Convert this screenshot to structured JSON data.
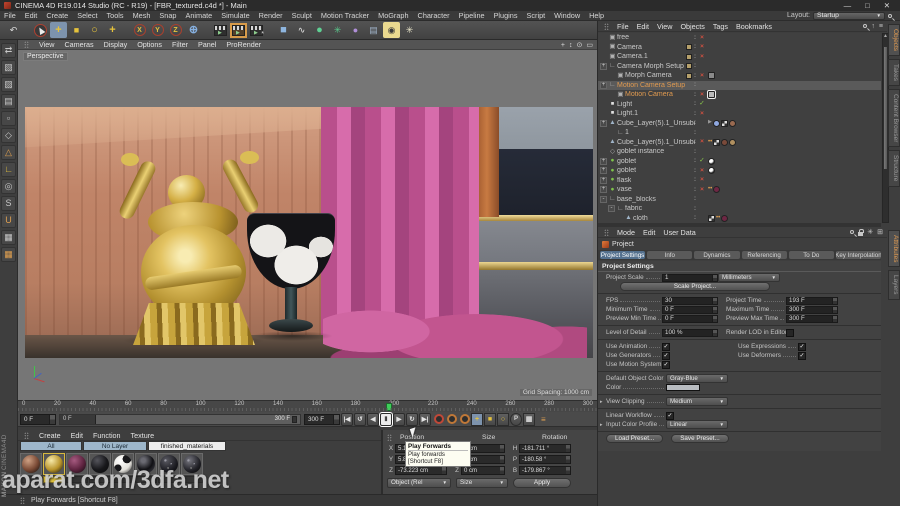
{
  "palette": {
    "accent_orange": "#e09a50",
    "tool_yellow": "#e6c33c",
    "select_blue": "#7d93ad",
    "tab_blue": "#53708e",
    "wood": "#c68e72",
    "wood_light": "#dcae8e",
    "pink": "#c9579a",
    "pink_light": "#d76cab",
    "pink_dark": "#a4447e",
    "sky": "#9aa2ab",
    "navy": "#262b38",
    "gold_trim": "#d8bc6c",
    "wall_gray": "#85888f",
    "gold_hi": "#f8ecb2",
    "gold_mid": "#d4af45",
    "gold_dark": "#6e5415",
    "viewport_gray": "#767676",
    "green_marker": "#3fcf5a",
    "check_green": "#8ed04a",
    "cross_red": "#d05040"
  },
  "window": {
    "title": "CINEMA 4D R19.014 Studio (RC - R19) - [FBR_textured.c4d *] - Main",
    "minimize": "—",
    "maximize": "□",
    "close": "✕"
  },
  "menubar": {
    "items": [
      "File",
      "Edit",
      "Create",
      "Select",
      "Tools",
      "Mesh",
      "Snap",
      "Animate",
      "Simulate",
      "Render",
      "Sculpt",
      "Motion Tracker",
      "MoGraph",
      "Character",
      "Pipeline",
      "Plugins",
      "Script",
      "Window",
      "Help"
    ],
    "layout_label": "Layout:",
    "layout_value": "Startup"
  },
  "main_toolbar": [
    {
      "name": "undo-icon",
      "g": "↶",
      "fg": "#dcdcdc"
    },
    {
      "name": "sep"
    },
    {
      "name": "live-selection-icon",
      "kind": "cursor"
    },
    {
      "name": "move-tool-icon",
      "g": "+",
      "fg": "#e6c33c",
      "bg": "#7d93ad",
      "big": true
    },
    {
      "name": "scale-tool-icon",
      "g": "■",
      "fg": "#e6c33c"
    },
    {
      "name": "rotate-tool-icon",
      "g": "○",
      "fg": "#e6c33c",
      "big": true
    },
    {
      "name": "last-tool-icon",
      "g": "+",
      "fg": "#e6c33c",
      "big": true
    },
    {
      "name": "sep"
    },
    {
      "name": "lock-x-axis-icon",
      "g": "X",
      "fg": "#e6c33c",
      "ring": "#a8402e"
    },
    {
      "name": "lock-y-axis-icon",
      "g": "Y",
      "fg": "#e6c33c",
      "ring": "#a8402e"
    },
    {
      "name": "lock-z-axis-icon",
      "g": "Z",
      "fg": "#e6c33c",
      "ring": "#a8402e"
    },
    {
      "name": "coordinate-system-icon",
      "g": "⊕",
      "fg": "#86b0e0",
      "big": true
    },
    {
      "name": "sep"
    },
    {
      "name": "render-view-icon",
      "kind": "clapper"
    },
    {
      "name": "render-picture-viewer-icon",
      "kind": "clapper",
      "hl": true
    },
    {
      "name": "render-settings-icon",
      "kind": "clapper",
      "gear": true
    },
    {
      "name": "sep"
    },
    {
      "name": "primitive-cube-icon",
      "g": "■",
      "fg": "#8fb6e0",
      "big": true
    },
    {
      "name": "spline-pen-icon",
      "g": "∿",
      "fg": "#e8e8e8"
    },
    {
      "name": "subdivision-surface-icon",
      "g": "●",
      "fg": "#5fd093",
      "big": true
    },
    {
      "name": "mograph-icon",
      "g": "✳",
      "fg": "#5acb8d"
    },
    {
      "name": "fields-icon",
      "g": "●",
      "fg": "#b08fd8"
    },
    {
      "name": "floor-icon",
      "g": "▤",
      "fg": "#9fb2c8"
    },
    {
      "name": "scene-camera-icon",
      "g": "◉",
      "fg": "#3a3a3a",
      "bg": "#ead98f"
    },
    {
      "name": "scene-light-icon",
      "g": "✳",
      "fg": "#e8e4c8"
    }
  ],
  "left_toolbar": [
    {
      "name": "make-editable-icon",
      "g": "⇄",
      "fg": "#c8c8c8"
    },
    {
      "name": "model-mode-icon",
      "g": "▧",
      "fg": "#c8c8c8"
    },
    {
      "name": "texture-mode-icon",
      "g": "▨",
      "fg": "#c8c8c8"
    },
    {
      "name": "workplane-mode-icon",
      "g": "▤",
      "fg": "#c8c8c8"
    },
    {
      "name": "points-mode-icon",
      "g": "▫",
      "fg": "#c8c8c8"
    },
    {
      "name": "edges-mode-icon",
      "g": "◇",
      "fg": "#c8c8c8"
    },
    {
      "name": "polygons-mode-icon",
      "g": "△",
      "fg": "#e0a050"
    },
    {
      "name": "enable-axis-icon",
      "g": "∟",
      "fg": "#e6c33c"
    },
    {
      "name": "viewport-solo-icon",
      "g": "◎",
      "fg": "#c8c8c8"
    },
    {
      "name": "snap-icon",
      "g": "S",
      "fg": "#c8c8c8"
    },
    {
      "name": "magnet-snap-icon",
      "g": "U",
      "fg": "#e0a050"
    },
    {
      "name": "workplane-icon",
      "g": "▦",
      "fg": "#c8c8c8"
    },
    {
      "name": "locked-workplane-icon",
      "g": "▦",
      "fg": "#e0a050"
    }
  ],
  "viewport": {
    "menu": [
      "View",
      "Cameras",
      "Display",
      "Options",
      "Filter",
      "Panel",
      "ProRender"
    ],
    "nav": [
      {
        "name": "pan-view-icon",
        "g": "+"
      },
      {
        "name": "zoom-view-icon",
        "g": "↕"
      },
      {
        "name": "rotate-view-icon",
        "g": "⊙"
      },
      {
        "name": "toggle-view-icon",
        "g": "▭"
      }
    ],
    "view_label": "Perspective",
    "grid_spacing": "Grid Spacing: 1000 cm"
  },
  "timeline": {
    "tick_labels": [
      "0",
      "20",
      "40",
      "60",
      "80",
      "100",
      "120",
      "140",
      "160",
      "180",
      "200",
      "220",
      "240",
      "260",
      "280",
      "300"
    ],
    "marker_frame": 193,
    "frame_max": 300,
    "current_frame": "0 F",
    "range_start": "0 F",
    "range_end": "300 F",
    "range_end_field": "300 F",
    "options_glyph": "≡"
  },
  "transport": [
    {
      "name": "goto-start-button",
      "g": "|◀"
    },
    {
      "name": "play-backwards-button",
      "g": "↺"
    },
    {
      "name": "previous-frame-button",
      "g": "◀"
    },
    {
      "name": "play-forwards-button",
      "g": "Ⅱ",
      "sel": true
    },
    {
      "name": "next-frame-button",
      "g": "▶"
    },
    {
      "name": "play-cycle-button",
      "g": "↻"
    },
    {
      "name": "goto-end-button",
      "g": "▶|"
    }
  ],
  "record_buttons": [
    {
      "name": "record-keyframe-button",
      "ring": "#c04838"
    },
    {
      "name": "autokeying-button",
      "ring": "#c07838"
    },
    {
      "name": "keyframe-presets-button",
      "ring": "#c07838"
    }
  ],
  "key_toggles": [
    {
      "name": "key-position-toggle",
      "g": "+",
      "fg": "#e6c33c",
      "bg": "#7d93ad"
    },
    {
      "name": "key-scale-toggle",
      "g": "■",
      "fg": "#e6c33c"
    },
    {
      "name": "key-rotation-toggle",
      "g": "○",
      "fg": "#e6c33c"
    },
    {
      "name": "key-parameter-toggle",
      "g": "P",
      "fg": "#d8d8d8",
      "circ": true
    },
    {
      "name": "key-pla-toggle",
      "g": "▦",
      "fg": "#d8d8d8"
    }
  ],
  "coordinates": {
    "position_label": "Position",
    "size_label": "Size",
    "rotation_label": "Rotation",
    "rows": [
      {
        "pl": "X",
        "pv": "5.144 cm",
        "sl": "X",
        "sv": "0 cm",
        "rl": "H",
        "rv": "-181.711 °"
      },
      {
        "pl": "Y",
        "pv": "5.865 cm",
        "sl": "Y",
        "sv": "0 cm",
        "rl": "P",
        "rv": "-180.58 °"
      },
      {
        "pl": "Z",
        "pv": "-73.223 cm",
        "sl": "Z",
        "sv": "0 cm",
        "rl": "B",
        "rv": "-179.867 °"
      }
    ],
    "mode_object": "Object (Rel",
    "mode_size": "Size",
    "apply_label": "Apply"
  },
  "materials": {
    "menu": [
      "Create",
      "Edit",
      "Function",
      "Texture"
    ],
    "tabs": [
      {
        "label": "All",
        "kind": "blue"
      },
      {
        "label": "No Layer",
        "kind": "blue"
      },
      {
        "label": "finished_materials",
        "kind": "active"
      }
    ],
    "spheres": [
      {
        "name": "copper-material",
        "high": "#cfa184",
        "base": "#7a4a35"
      },
      {
        "name": "gold-material",
        "high": "#f6e9a8",
        "base": "#b8932a",
        "selected": true
      },
      {
        "name": "plum-material",
        "high": "#a65a80",
        "base": "#5e2440"
      },
      {
        "name": "black-material",
        "high": "#55555c",
        "base": "#17171a"
      },
      {
        "name": "cow-material",
        "high": "#ffffff",
        "base": "#e2e0da",
        "pattern": "cow"
      },
      {
        "name": "black-glossy-material",
        "high": "#6a6a72",
        "base": "#101014",
        "pattern": "rim"
      },
      {
        "name": "dark-pattern-material",
        "high": "#5a5a62",
        "base": "#1c1c22",
        "pattern": "speckle"
      },
      {
        "name": "dark-speckle-material",
        "high": "#777780",
        "base": "#202026",
        "pattern": "speckle"
      }
    ],
    "label_highlight": "#e0c23c"
  },
  "tooltip": {
    "title": "Play Forwards",
    "line2": "Play forwards",
    "line3": "[Shortcut F8]"
  },
  "status_bar": {
    "text": "Play Forwards [Shortcut F8]"
  },
  "brand": {
    "line1": "MAXON",
    "line2": "CINEMA4D"
  },
  "watermark": {
    "text": "aparat.com/3dfa.net"
  },
  "object_manager": {
    "menu": [
      "File",
      "Edit",
      "View",
      "Objects",
      "Tags",
      "Bookmarks"
    ],
    "rows": [
      {
        "n": "free",
        "icon": "cam",
        "mark": "x"
      },
      {
        "n": "Camera",
        "icon": "cam",
        "chip": "#b5a06b",
        "mark": "x"
      },
      {
        "n": "Camera.1",
        "icon": "cam",
        "chip": "#b5a06b",
        "mark": "x"
      },
      {
        "n": "Camera Morph Setup",
        "icon": "null",
        "exp": "+",
        "chip": "#b5a06b"
      },
      {
        "n": "Morph Camera",
        "icon": "cam",
        "ind": 1,
        "chip": "#b5a06b",
        "mark": "x",
        "tags": [
          {
            "type": "cam"
          }
        ]
      },
      {
        "n": "Motion Camera Setup",
        "icon": "null",
        "exp": "+",
        "orange": true,
        "sel": true
      },
      {
        "n": "Motion Camera",
        "icon": "cam",
        "ind": 1,
        "orange": true,
        "mark": "x",
        "tags": [
          {
            "type": "sel-box"
          }
        ]
      },
      {
        "n": "Light",
        "icon": "light",
        "mark": "check"
      },
      {
        "n": "Light.1",
        "icon": "light",
        "mark": "x"
      },
      {
        "n": "Cube_Layer(5).1_Unsubdivided",
        "icon": "poly",
        "exp": "+",
        "tags": [
          {
            "type": "arrow"
          },
          {
            "type": "ball",
            "c": "#8fa8e0"
          },
          {
            "type": "checker"
          },
          {
            "type": "ball",
            "c": "#9a6a50"
          }
        ]
      },
      {
        "n": "1",
        "icon": "null",
        "ind": 1
      },
      {
        "n": "Cube_Layer(5).1_Unsubdivided",
        "icon": "poly",
        "mark": "x",
        "tags": [
          {
            "type": "dots"
          },
          {
            "type": "checker"
          },
          {
            "type": "ball",
            "c": "#7a4a3a"
          },
          {
            "type": "ball",
            "c": "#b09060"
          }
        ]
      },
      {
        "n": "goblet instance",
        "icon": "inst"
      },
      {
        "n": "goblet",
        "icon": "gen",
        "exp": "+",
        "mark": "check",
        "tags": [
          {
            "type": "ball-bw"
          }
        ]
      },
      {
        "n": "goblet",
        "icon": "gen",
        "exp": "+",
        "mark": "x",
        "tags": [
          {
            "type": "ball-bw"
          }
        ]
      },
      {
        "n": "flask",
        "icon": "gen",
        "exp": "+",
        "mark": "x"
      },
      {
        "n": "vase",
        "icon": "gen",
        "exp": "+",
        "mark": "x",
        "tags": [
          {
            "type": "dots"
          },
          {
            "type": "ball",
            "c": "#6e2744"
          }
        ]
      },
      {
        "n": "base_blocks",
        "icon": "null",
        "exp": "-"
      },
      {
        "n": "fabric",
        "icon": "null",
        "ind": 1,
        "exp": "-"
      },
      {
        "n": "cloth",
        "icon": "poly",
        "ind": 2,
        "tags": [
          {
            "type": "checker"
          },
          {
            "type": "dots"
          },
          {
            "type": "ball",
            "c": "#6e2744"
          }
        ]
      }
    ]
  },
  "side_tabs": {
    "top": [
      {
        "label": "Objects",
        "active": true
      },
      {
        "label": "Takes",
        "active": false
      },
      {
        "label": "Content Browser",
        "active": false
      },
      {
        "label": "Structure",
        "active": false
      }
    ],
    "bottom": [
      {
        "label": "Attributes",
        "active": true
      },
      {
        "label": "Layers",
        "active": false
      }
    ]
  },
  "attributes": {
    "menu": [
      "Mode",
      "Edit",
      "User Data"
    ],
    "object_label": "Project",
    "tabs": [
      {
        "label": "Project Settings",
        "active": true
      },
      {
        "label": "Info"
      },
      {
        "label": "Dynamics"
      },
      {
        "label": "Referencing"
      },
      {
        "label": "To Do"
      },
      {
        "label": "Key Interpolation"
      }
    ],
    "rows": [
      {
        "t": "section",
        "label": "Project Settings"
      },
      {
        "t": "fd",
        "label": "Project Scale",
        "value": "1",
        "dropdown": "Millimeters"
      },
      {
        "t": "btnwide",
        "label": "Scale Project..."
      },
      {
        "t": "sep"
      },
      {
        "t": "ff",
        "l1": "FPS",
        "v1": "30",
        "l2": "Project Time",
        "v2": "193 F"
      },
      {
        "t": "ff",
        "l1": "Minimum Time",
        "v1": "0 F",
        "l2": "Maximum Time",
        "v2": "300 F"
      },
      {
        "t": "ff",
        "l1": "Preview Min Time",
        "v1": "0 F",
        "l2": "Preview Max Time",
        "v2": "300 F"
      },
      {
        "t": "sep"
      },
      {
        "t": "fc",
        "l1": "Level of Detail",
        "v1": "100 %",
        "l2": "Render LOD in Editor",
        "checked": false
      },
      {
        "t": "sep"
      },
      {
        "t": "cc",
        "l1": "Use Animation",
        "c1": true,
        "l2": "Use Expressions",
        "c2": true
      },
      {
        "t": "cc",
        "l1": "Use Generators",
        "c1": true,
        "l2": "Use Deformers",
        "c2": true
      },
      {
        "t": "cc",
        "l1": "Use Motion System",
        "c1": true
      },
      {
        "t": "sep"
      },
      {
        "t": "dd",
        "label": "Default Object Color",
        "value": "Gray-Blue"
      },
      {
        "t": "color",
        "label": "Color"
      },
      {
        "t": "sep"
      },
      {
        "t": "dd",
        "label": "View Clipping",
        "value": "Medium",
        "exp": true
      },
      {
        "t": "sep"
      },
      {
        "t": "check",
        "label": "Linear Workflow",
        "checked": true
      },
      {
        "t": "dd",
        "label": "Input Color Profile",
        "value": "Linear",
        "exp": true
      },
      {
        "t": "sep"
      },
      {
        "t": "presets",
        "b1": "Load Preset...",
        "b2": "Save Preset..."
      }
    ]
  }
}
